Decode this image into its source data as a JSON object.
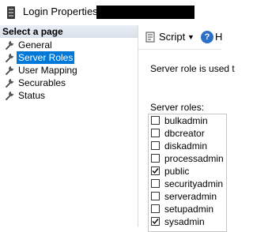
{
  "window": {
    "title": "Login Properties -",
    "title_icon": "login-properties-icon"
  },
  "left_pane": {
    "header": "Select a page",
    "items": [
      {
        "label": "General",
        "icon": "wrench-icon",
        "selected": false
      },
      {
        "label": "Server Roles",
        "icon": "wrench-icon",
        "selected": true
      },
      {
        "label": "User Mapping",
        "icon": "wrench-icon",
        "selected": false
      },
      {
        "label": "Securables",
        "icon": "wrench-icon",
        "selected": false
      },
      {
        "label": "Status",
        "icon": "wrench-icon",
        "selected": false
      }
    ]
  },
  "toolbar": {
    "script_label": "Script",
    "script_dropdown_icon": "chevron-down-icon",
    "help_label": "H"
  },
  "content": {
    "description": "Server role is used t",
    "roles_label": "Server roles:",
    "roles": [
      {
        "name": "bulkadmin",
        "checked": false
      },
      {
        "name": "dbcreator",
        "checked": false
      },
      {
        "name": "diskadmin",
        "checked": false
      },
      {
        "name": "processadmin",
        "checked": false
      },
      {
        "name": "public",
        "checked": true
      },
      {
        "name": "securityadmin",
        "checked": false
      },
      {
        "name": "serveradmin",
        "checked": false
      },
      {
        "name": "setupadmin",
        "checked": false
      },
      {
        "name": "sysadmin",
        "checked": true
      }
    ]
  },
  "colors": {
    "selection": "#0078d7",
    "help_icon": "#2b6fc7"
  }
}
